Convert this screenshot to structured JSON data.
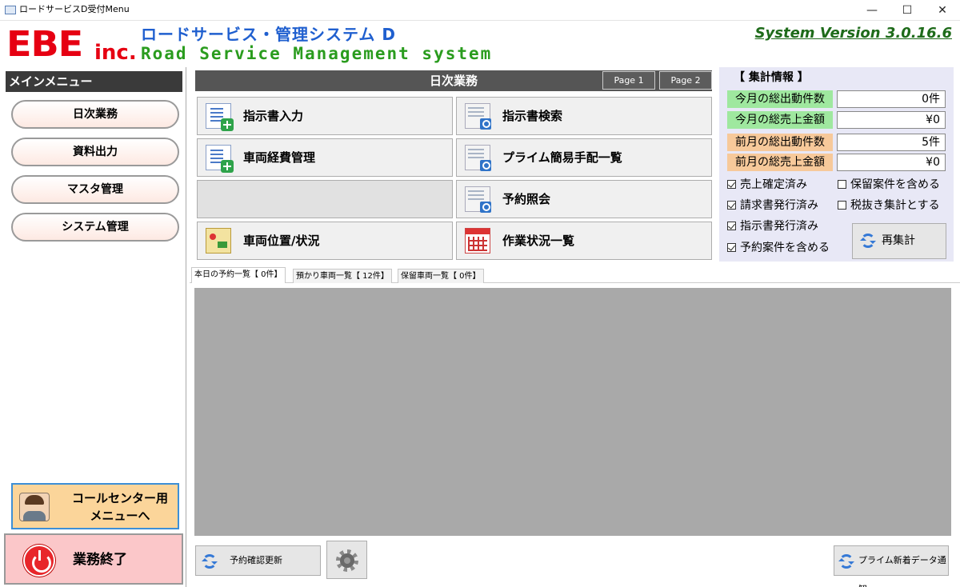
{
  "window": {
    "title": "ロードサービスD受付Menu",
    "minimize": "—",
    "maximize": "☐",
    "close": "✕"
  },
  "header": {
    "logo_main": "EBE",
    "logo_sub": "inc.",
    "app_name_jp": "ロードサービス・管理システム D",
    "app_name_en": "Road Service Management system",
    "version": "System Version 3.0.16.6"
  },
  "sidebar": {
    "heading": "メインメニュー",
    "items": [
      {
        "label": "日次業務"
      },
      {
        "label": "資料出力"
      },
      {
        "label": "マスタ管理"
      },
      {
        "label": "システム管理"
      }
    ],
    "callcenter_line1": "コールセンター用",
    "callcenter_line2": "メニューへ",
    "exit_label": "業務終了"
  },
  "daily": {
    "title": "日次業務",
    "page1": "Page 1",
    "page2": "Page 2",
    "buttons": {
      "order_entry": "指示書入力",
      "order_search": "指示書検索",
      "vehicle_cost": "車両経費管理",
      "prime_list": "プライム簡易手配一覧",
      "reservation": "予約照会",
      "vehicle_position": "車両位置/状況",
      "work_status": "作業状況一覧"
    }
  },
  "summary": {
    "title": "【 集計情報 】",
    "rows": [
      {
        "label": "今月の総出動件数",
        "value": "0件",
        "color": "#9fe89f"
      },
      {
        "label": "今月の総売上金額",
        "value": "¥0",
        "color": "#9fe89f"
      },
      {
        "label": "前月の総出動件数",
        "value": "5件",
        "color": "#f7c99a"
      },
      {
        "label": "前月の総売上金額",
        "value": "¥0",
        "color": "#f7c99a"
      }
    ],
    "checks": {
      "sales_confirmed": {
        "label": "売上確定済み",
        "checked": true
      },
      "include_hold": {
        "label": "保留案件を含める",
        "checked": false
      },
      "invoice_issued": {
        "label": "請求書発行済み",
        "checked": true
      },
      "tax_excluded": {
        "label": "税抜き集計とする",
        "checked": false
      },
      "order_issued": {
        "label": "指示書発行済み",
        "checked": true
      },
      "include_reservation": {
        "label": "予約案件を含める",
        "checked": true
      }
    },
    "recalc_label": "再集計"
  },
  "tabs": [
    {
      "label": "本日の予約一覧【 0件】"
    },
    {
      "label": "預かり車両一覧【 12件】"
    },
    {
      "label": "保留車両一覧【 0件】"
    }
  ],
  "bottom": {
    "refresh_reservations": "予約確認更新",
    "prime_notice": "プライム新着データ通知"
  }
}
